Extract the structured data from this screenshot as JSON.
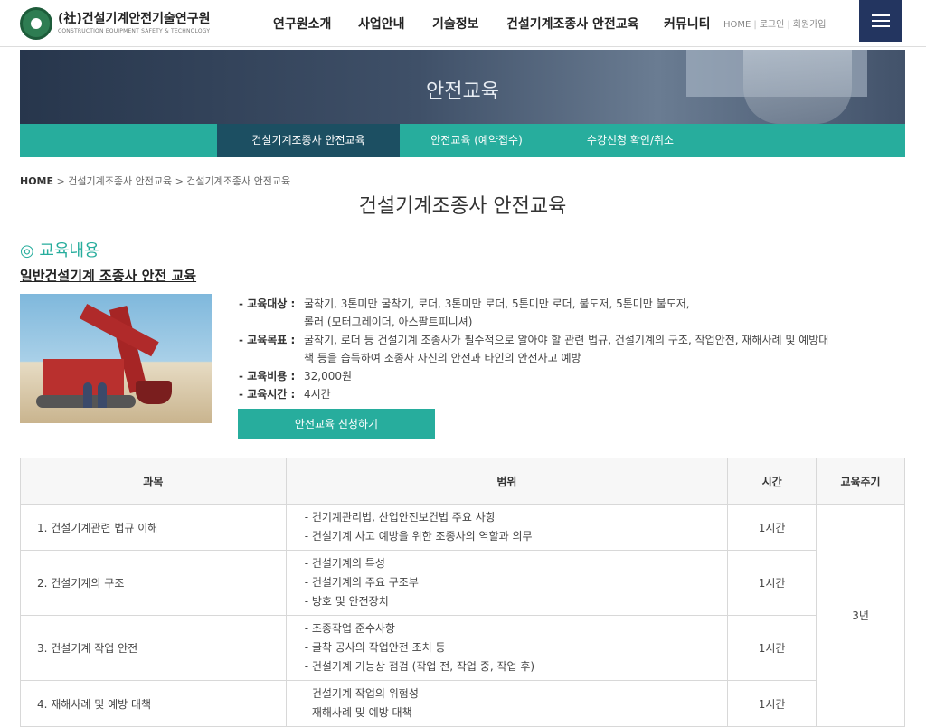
{
  "header": {
    "logo_title": "(社)건설기계안전기술연구원",
    "logo_sub": "CONSTRUCTION EQUIPMENT SAFETY & TECHNOLOGY",
    "nav": [
      "연구원소개",
      "사업안내",
      "기술정보",
      "건설기계조종사 안전교육",
      "커뮤니티"
    ],
    "util": [
      "HOME",
      "로그인",
      "회원가입"
    ],
    "menu_icon": "hamburger-icon"
  },
  "banner": {
    "title": "안전교육"
  },
  "subnav": {
    "items": [
      "건설기계조종사 안전교육",
      "안전교육 (예약접수)",
      "수강신청 확인/취소"
    ],
    "active_index": 0
  },
  "breadcrumb": {
    "items": [
      "HOME",
      "건설기계조종사 안전교육",
      "건설기계조종사 안전교육"
    ]
  },
  "page": {
    "title": "건설기계조종사 안전교육",
    "section_heading": "◎ 교육내용",
    "course_title": "일반건설기계 조종사 안전 교육"
  },
  "info": {
    "target_label": "- 교육대상 :",
    "target_value": "굴착기, 3톤미만 굴착기, 로더, 3톤미만 로더, 5톤미만 로더, 불도저, 5톤미만 불도저,",
    "target_value_2": "롤러 (모터그레이더, 아스팔트피니셔)",
    "goal_label": "- 교육목표 :",
    "goal_value": "굴착기, 로더 등 건설기계 조종사가 필수적으로 알아야 할 관련 법규, 건설기계의 구조, 작업안전, 재해사례 및 예방대",
    "goal_value_2": "책 등을 습득하여 조종사 자신의 안전과 타인의 안전사고 예방",
    "cost_label": "- 교육비용 :",
    "cost_value": "32,000원",
    "time_label": "- 교육시간 :",
    "time_value": "4시간"
  },
  "apply_button": "안전교육 신청하기",
  "table": {
    "headers": [
      "과목",
      "범위",
      "시간",
      "교육주기"
    ],
    "cycle": "3년",
    "rows": [
      {
        "subject": "1. 건설기계관련 법규 이해",
        "range": [
          "- 건기계관리법, 산업안전보건법 주요 사항",
          "- 건설기계 사고 예방을 위한 조종사의 역할과 의무"
        ],
        "time": "1시간"
      },
      {
        "subject": "2. 건설기계의 구조",
        "range": [
          "- 건설기계의 특성",
          "- 건설기계의 주요 구조부",
          "- 방호 및 안전장치"
        ],
        "time": "1시간"
      },
      {
        "subject": "3. 건설기계 작업 안전",
        "range": [
          "- 조종작업 준수사항",
          "- 굴착 공사의 작업안전 조치 등",
          "- 건설기계 기능상 점검 (작업 전, 작업 중, 작업 후)"
        ],
        "time": "1시간"
      },
      {
        "subject": "4. 재해사례 및 예방 대책",
        "range": [
          "- 건설기계 작업의 위험성",
          "- 재해사례 및 예방 대책"
        ],
        "time": "1시간"
      }
    ]
  }
}
